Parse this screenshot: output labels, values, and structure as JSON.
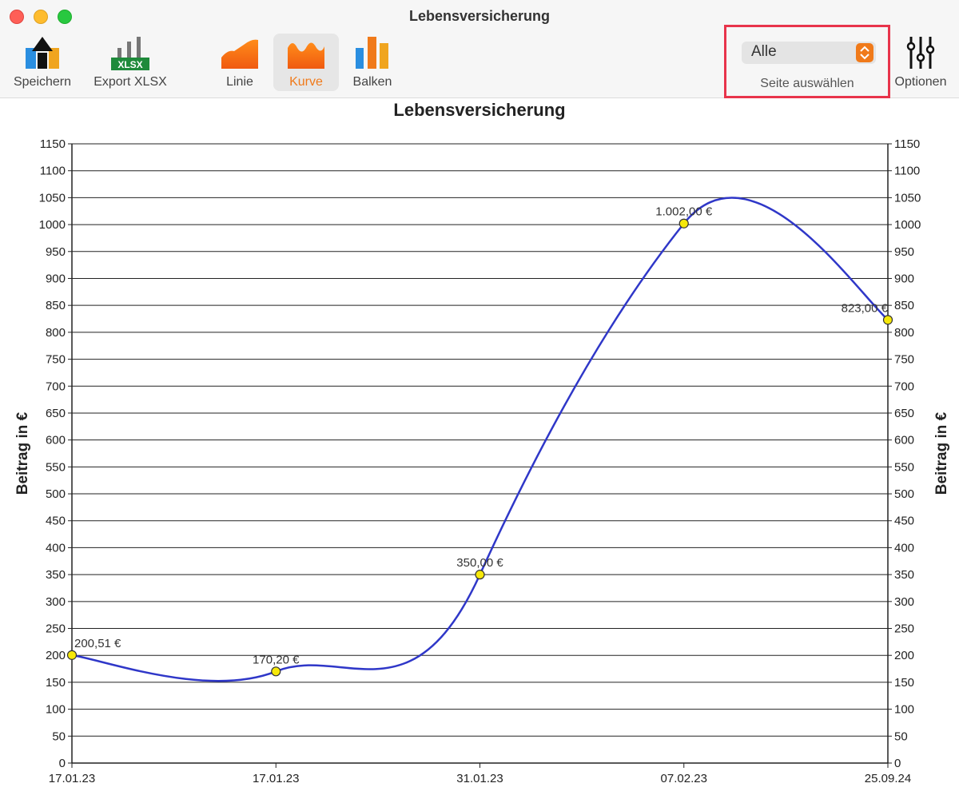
{
  "window": {
    "title": "Lebensversicherung"
  },
  "toolbar": {
    "items": [
      {
        "id": "save",
        "label": "Speichern",
        "icon": "save-upload-icon"
      },
      {
        "id": "export",
        "label": "Export XLSX",
        "icon": "xlsx-export-icon",
        "badge": "XLSX"
      },
      {
        "id": "line",
        "label": "Linie",
        "icon": "line-chart-icon"
      },
      {
        "id": "curve",
        "label": "Kurve",
        "icon": "curve-chart-icon",
        "active": true
      },
      {
        "id": "bars",
        "label": "Balken",
        "icon": "bar-chart-icon"
      },
      {
        "id": "options",
        "label": "Optionen",
        "icon": "sliders-icon"
      }
    ],
    "page_select": {
      "value": "Alle",
      "label": "Seite auswählen"
    }
  },
  "colors": {
    "accent": "#f07a1a",
    "curve": "#2f37c8",
    "marker": "#f6e80a",
    "highlight": "#e8344b"
  },
  "chart_data": {
    "type": "line",
    "title": "Lebensversicherung",
    "ylabel": "Beitrag in €",
    "ylabel_right": "Beitrag in €",
    "categories": [
      "17.01.23",
      "17.01.23",
      "31.01.23",
      "07.02.23",
      "25.09.24"
    ],
    "values": [
      200.51,
      170.2,
      350.0,
      1002.0,
      823.0
    ],
    "data_labels": [
      "200,51 €",
      "170,20 €",
      "350,00 €",
      "1.002,00 €",
      "823,00 €"
    ],
    "ylim": [
      0,
      1150
    ],
    "yticks": [
      0,
      50,
      100,
      150,
      200,
      250,
      300,
      350,
      400,
      450,
      500,
      550,
      600,
      650,
      700,
      750,
      800,
      850,
      900,
      950,
      1000,
      1050,
      1100,
      1150
    ],
    "grid": true,
    "smooth": true
  }
}
